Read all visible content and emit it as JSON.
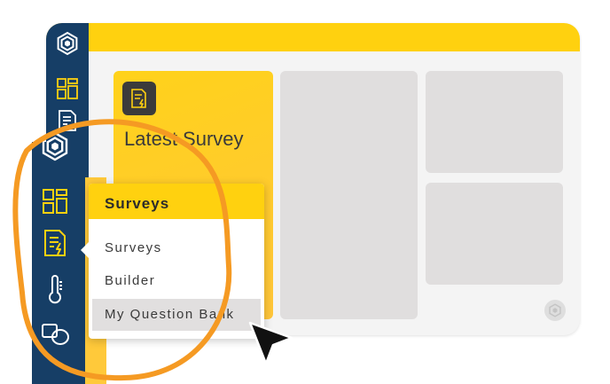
{
  "colors": {
    "brand_yellow": "#ffd10f",
    "sidebar_navy": "#163e66",
    "highlight_orange": "#f59a23",
    "placeholder_gray": "#e0dede",
    "menu_active": "#e1dfdf"
  },
  "background": {
    "survey_card": {
      "title": "Latest Survey",
      "icon": "survey-document-icon"
    },
    "sidebar_icons": [
      "hexagon-logo-icon",
      "dashboard-grid-icon",
      "survey-document-icon"
    ]
  },
  "zoom": {
    "sidebar_icons": [
      "hexagon-logo-icon",
      "dashboard-grid-icon",
      "survey-document-icon",
      "thermometer-icon",
      "chat-icon"
    ]
  },
  "menu": {
    "header": "Surveys",
    "items": [
      {
        "label": "Surveys",
        "active": false
      },
      {
        "label": "Builder",
        "active": false
      },
      {
        "label": "My Question Bank",
        "active": true
      }
    ]
  }
}
